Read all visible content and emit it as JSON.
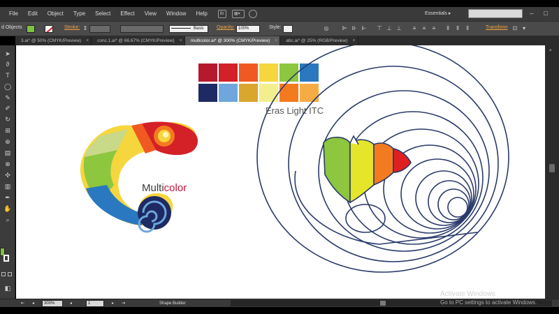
{
  "app": {
    "menu": [
      "File",
      "Edit",
      "Object",
      "Type",
      "Select",
      "Effect",
      "View",
      "Window",
      "Help"
    ],
    "bridge_label": "Br",
    "workspace": "Essentials",
    "workspace_arrow": "▸"
  },
  "control_bar": {
    "selection_label": "d Objects",
    "stroke_label": "Stroke:",
    "brush_label": "Basic",
    "opacity_label": "Opacity:",
    "opacity_value": "100%",
    "style_label": "Style:",
    "transform_label": "Transform",
    "fill_color": "#7ec242"
  },
  "tabs": [
    {
      "label": "3.ai* @ 50% (CMYK/Preview)",
      "active": false
    },
    {
      "label": "conc.1.ai* @ 66.67% (CMYK/Preview)",
      "active": false
    },
    {
      "label": "multicolor.ai* @ 300% (CMYK/Preview)",
      "active": true
    },
    {
      "label": "abc.ai* @ 25% (RGB/Preview)",
      "active": false
    }
  ],
  "tab_close_glyph": "×",
  "artwork": {
    "logo_text_prefix": "Multi",
    "logo_text_suffix": "color",
    "font_name": "Eras Light ITC",
    "palette_row1": [
      "#b5192e",
      "#d42027",
      "#f05a22",
      "#f5d63d",
      "#8dc63f",
      "#2a78bf"
    ],
    "palette_row2": [
      "#1e2a63",
      "#6fa6dc",
      "#d9a62e",
      "#f3ef8f",
      "#f47a20",
      "#f6ac45"
    ]
  },
  "status_bar": {
    "zoom": "300%",
    "artboard": "1",
    "tool_name": "Shape Builder"
  },
  "watermark": {
    "title": "Activate Windows",
    "subtitle": "Go to PC settings to activate Windows."
  }
}
